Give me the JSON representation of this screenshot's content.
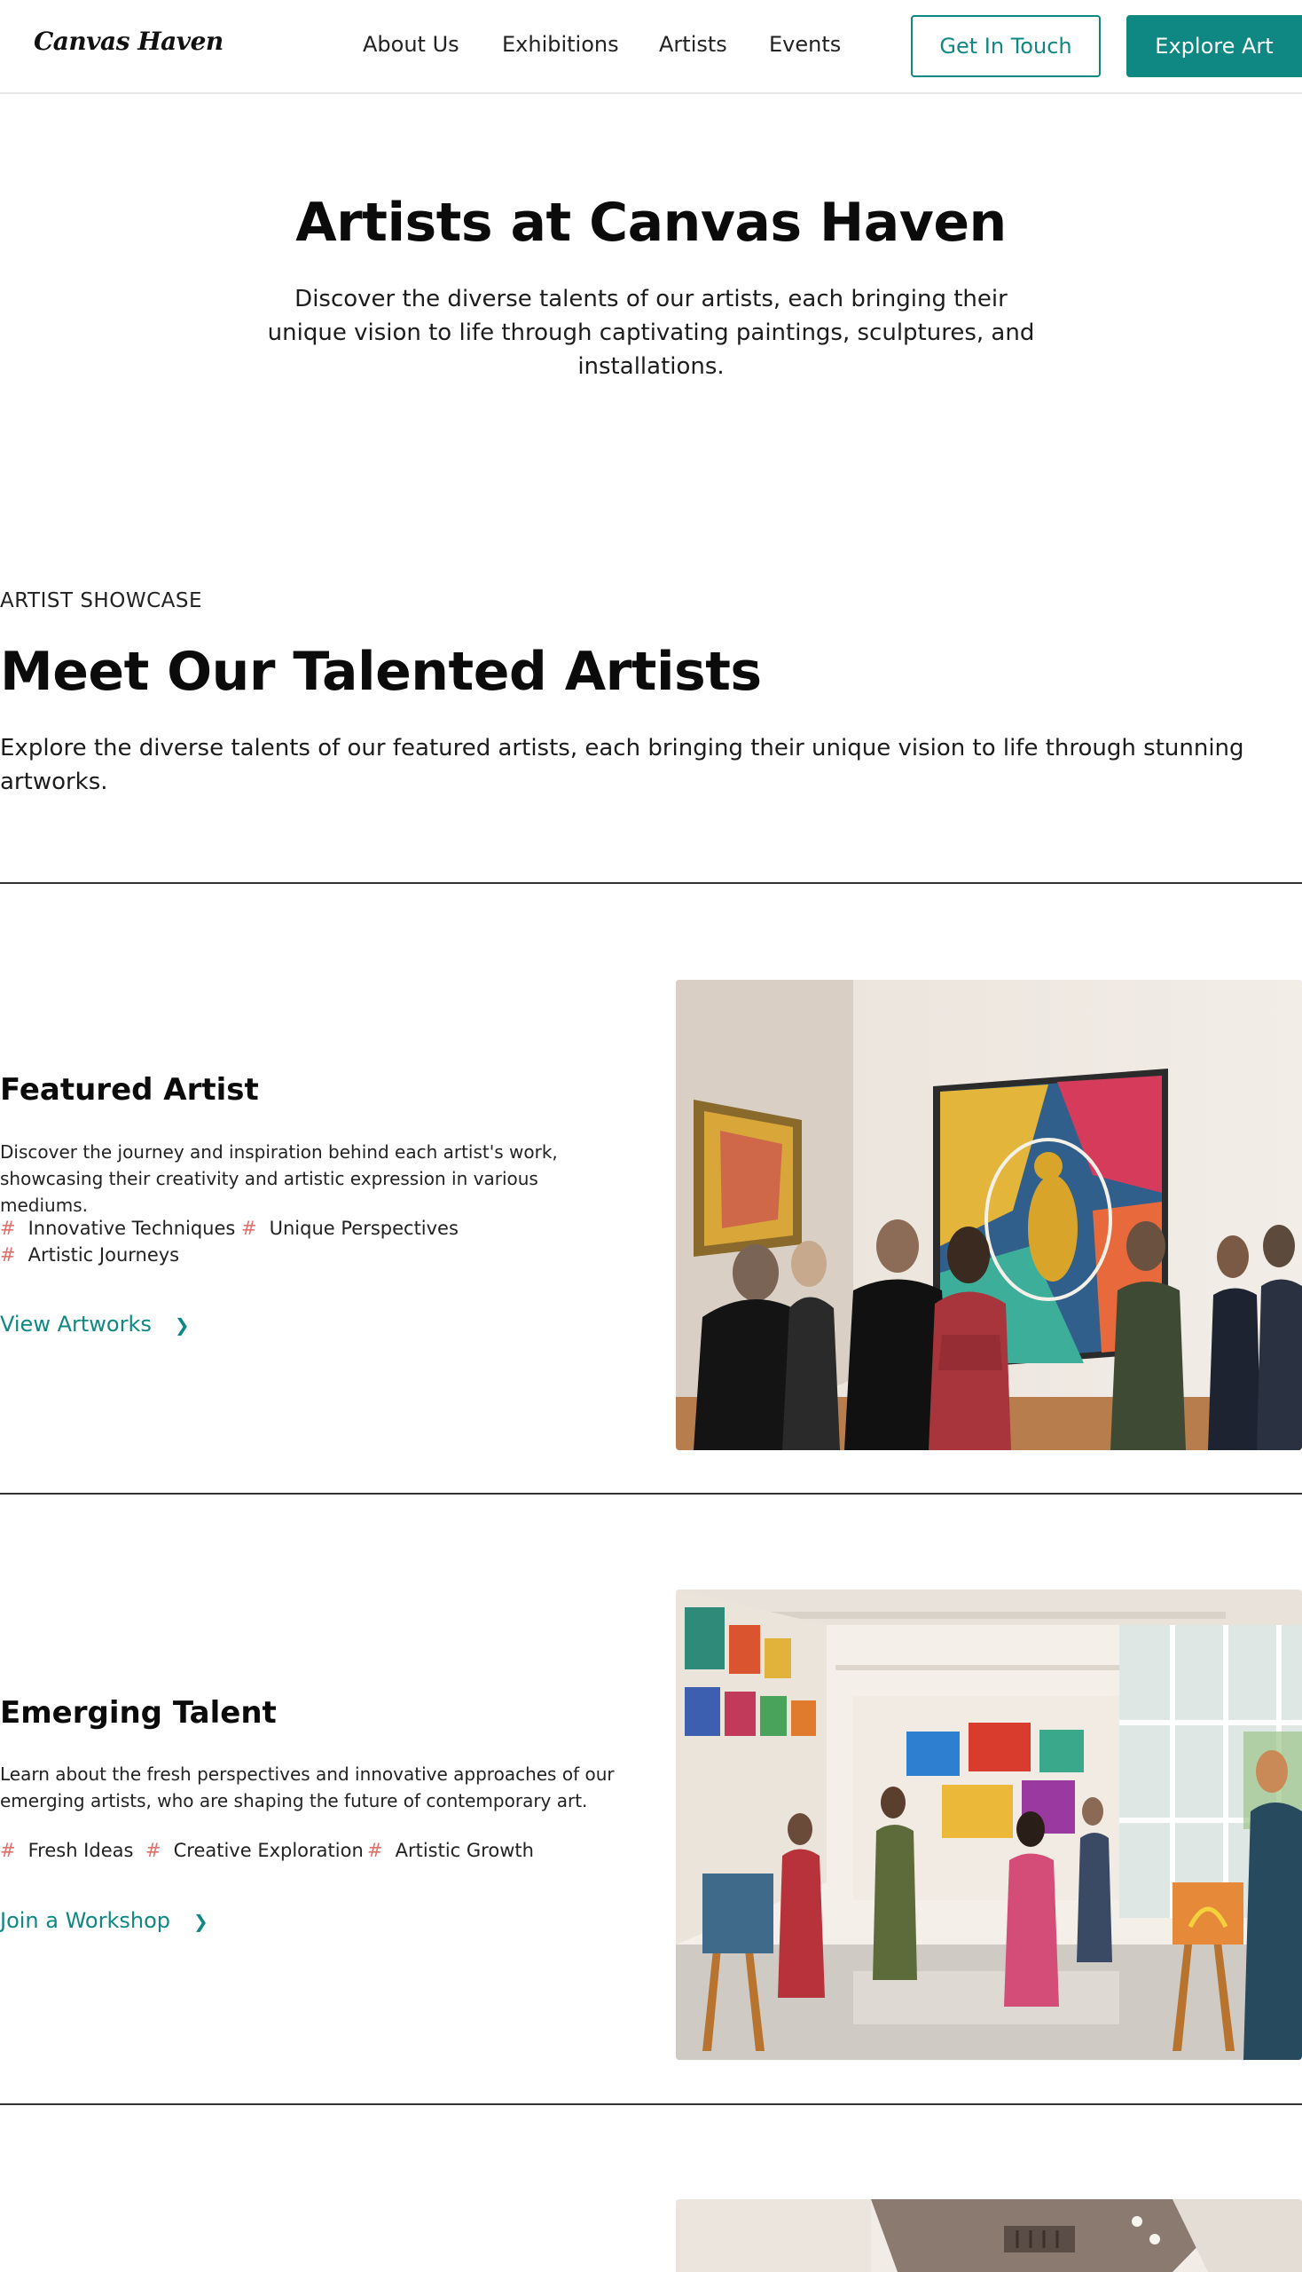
{
  "header": {
    "logo": "Canvas Haven",
    "nav": [
      "About Us",
      "Exhibitions",
      "Artists",
      "Events"
    ],
    "cta_outline": "Get In Touch",
    "cta_solid": "Explore Art"
  },
  "hero": {
    "title": "Artists at Canvas Haven",
    "subtitle": "Discover the diverse talents of our artists, each bringing their unique vision to life through captivating paintings, sculptures, and installations."
  },
  "showcase": {
    "eyebrow": "ARTIST SHOWCASE",
    "title": "Meet Our Talented Artists",
    "subtitle": "Explore the diverse talents of our featured artists, each bringing their unique vision to life through stunning artworks."
  },
  "blocks": [
    {
      "title": "Featured Artist",
      "description": "Discover the journey and inspiration behind each artist's work, showcasing their creativity and artistic expression in various mediums.",
      "tags": [
        "Innovative Techniques",
        "Unique Perspectives",
        "Artistic Journeys"
      ],
      "link": "View Artworks"
    },
    {
      "title": "Emerging Talent",
      "description": "Learn about the fresh perspectives and innovative approaches of our emerging artists, who are shaping the future of contemporary art.",
      "tags": [
        "Fresh Ideas",
        "Creative Exploration",
        "Artistic Growth"
      ],
      "link": "Join a Workshop"
    }
  ],
  "colors": {
    "accent": "#0f8782",
    "tag_hash": "#e0706a",
    "text": "#111111",
    "divider": "#333333"
  },
  "icons": {
    "link_arrow": "chevron-right-icon",
    "tag_marker": "hash-icon"
  }
}
